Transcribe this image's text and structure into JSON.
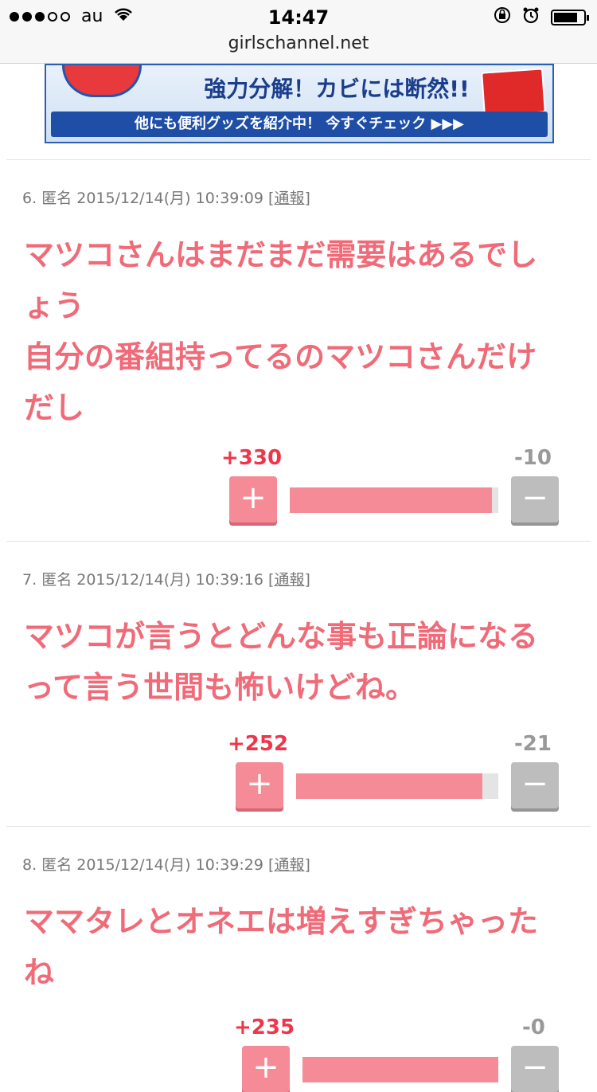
{
  "status_bar": {
    "carrier": "au",
    "time": "14:47",
    "url": "girlschannel.net"
  },
  "banner": {
    "headline": "強力分解！カビには断然!!",
    "cta": "他にも便利グッズを紹介中！ 今すぐチェック ▶▶▶"
  },
  "comments": [
    {
      "number": "6.",
      "author": "匿名",
      "datetime": "2015/12/14(月) 10:39:09",
      "report": "通報",
      "lines": [
        "マツコさんはまだまだ需要はあるでし",
        "ょう",
        "自分の番組持ってるのマツコさんだけ",
        "だし"
      ],
      "plus": "+330",
      "minus": "-10",
      "plus_ratio": 0.97
    },
    {
      "number": "7.",
      "author": "匿名",
      "datetime": "2015/12/14(月) 10:39:16",
      "report": "通報",
      "lines": [
        "マツコが言うとどんな事も正論になる",
        "って言う世間も怖いけどね。"
      ],
      "plus": "+252",
      "minus": "-21",
      "plus_ratio": 0.92
    },
    {
      "number": "8.",
      "author": "匿名",
      "datetime": "2015/12/14(月) 10:39:29",
      "report": "通報",
      "lines": [
        "ママタレとオネエは増えすぎちゃった",
        "ね"
      ],
      "plus": "+235",
      "minus": "-0",
      "plus_ratio": 1.0
    }
  ],
  "icons": {
    "plus": "+",
    "minus": "−"
  }
}
